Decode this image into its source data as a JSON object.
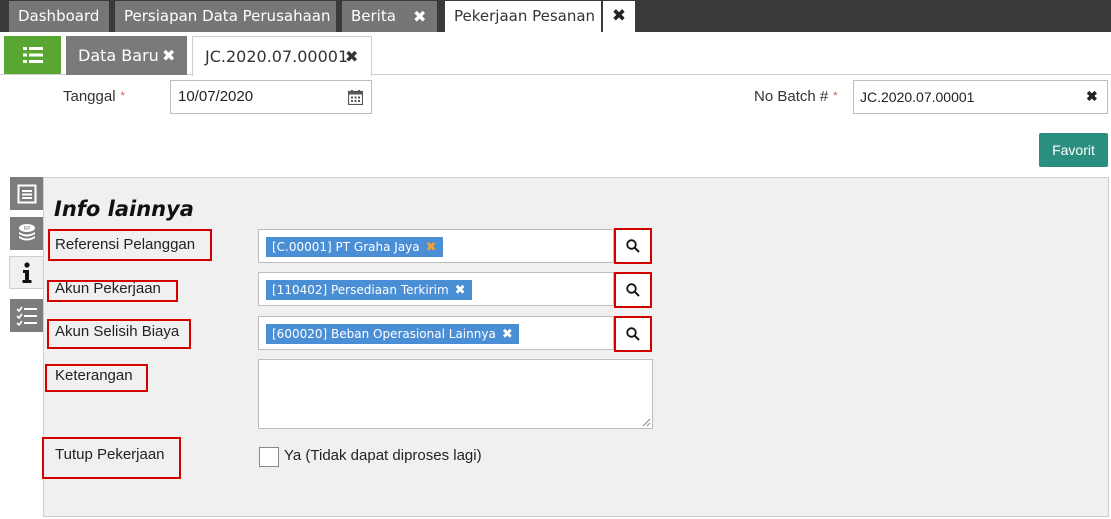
{
  "top_tabs": [
    {
      "label": "Dashboard"
    },
    {
      "label": "Persiapan Data Perusahaan"
    },
    {
      "label": "Berita"
    },
    {
      "label": "Pekerjaan Pesanan"
    }
  ],
  "close_glyph": "✖",
  "sub_tabs": {
    "data_baru": "Data Baru",
    "current": "JC.2020.07.00001"
  },
  "form": {
    "tanggal_label": "Tanggal",
    "tanggal_value": "10/07/2020",
    "required_mark": "*",
    "batch_label": "No Batch #",
    "batch_value": "JC.2020.07.00001",
    "favorit_label": "Favorit"
  },
  "section": {
    "title": "Info lainnya",
    "referensi_label": "Referensi Pelanggan",
    "referensi_value": "[C.00001] PT Graha Jaya",
    "akun_pekerjaan_label": "Akun Pekerjaan",
    "akun_pekerjaan_value": "[110402] Persediaan Terkirim",
    "akun_selisih_label": "Akun Selisih Biaya",
    "akun_selisih_value": "[600020] Beban Operasional Lainnya",
    "keterangan_label": "Keterangan",
    "keterangan_value": "",
    "tutup_label": "Tutup Pekerjaan",
    "tutup_checkbox_label": "Ya (Tidak dapat diproses lagi)",
    "tutup_checked": false
  },
  "colors": {
    "accent_green": "#5aa632",
    "favorit_teal": "#2b8f80",
    "chip_blue": "#4a8ed6",
    "highlight_red": "#d40000",
    "chip_remove_orange": "#f0a030"
  }
}
